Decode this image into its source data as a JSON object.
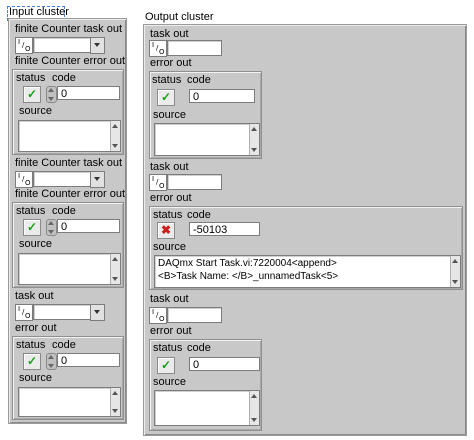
{
  "input_cluster": {
    "label": "Input cluster",
    "task_out_1": "finite Counter task out",
    "error_out_1": "finite Counter error out",
    "task_out_2": "finite Counter task out",
    "error_out_2": "finite Counter error out",
    "task_out_3": "task out",
    "error_out_3": "error out"
  },
  "output_cluster": {
    "label": "Output cluster",
    "task_out_1": "task out",
    "error_out_1": "error out",
    "task_out_2": "task out",
    "error_out_2": "error out",
    "task_out_3": "task out",
    "error_out_3": "error out"
  },
  "labels": {
    "status": "status",
    "code": "code",
    "source": "source",
    "io_glyph": "I/O"
  },
  "values": {
    "code_zero": "0",
    "code_error": "-50103",
    "source_error_line1": "DAQmx Start Task.vi:7220004<append>",
    "source_error_line2": "<B>Task Name: </B>_unnamedTask<5>",
    "status_ok_glyph": "✓",
    "status_err_glyph": "✖"
  },
  "colors": {
    "ok": "#1aa01a",
    "error": "#c81e1e",
    "panel": "#c8c8c8"
  }
}
